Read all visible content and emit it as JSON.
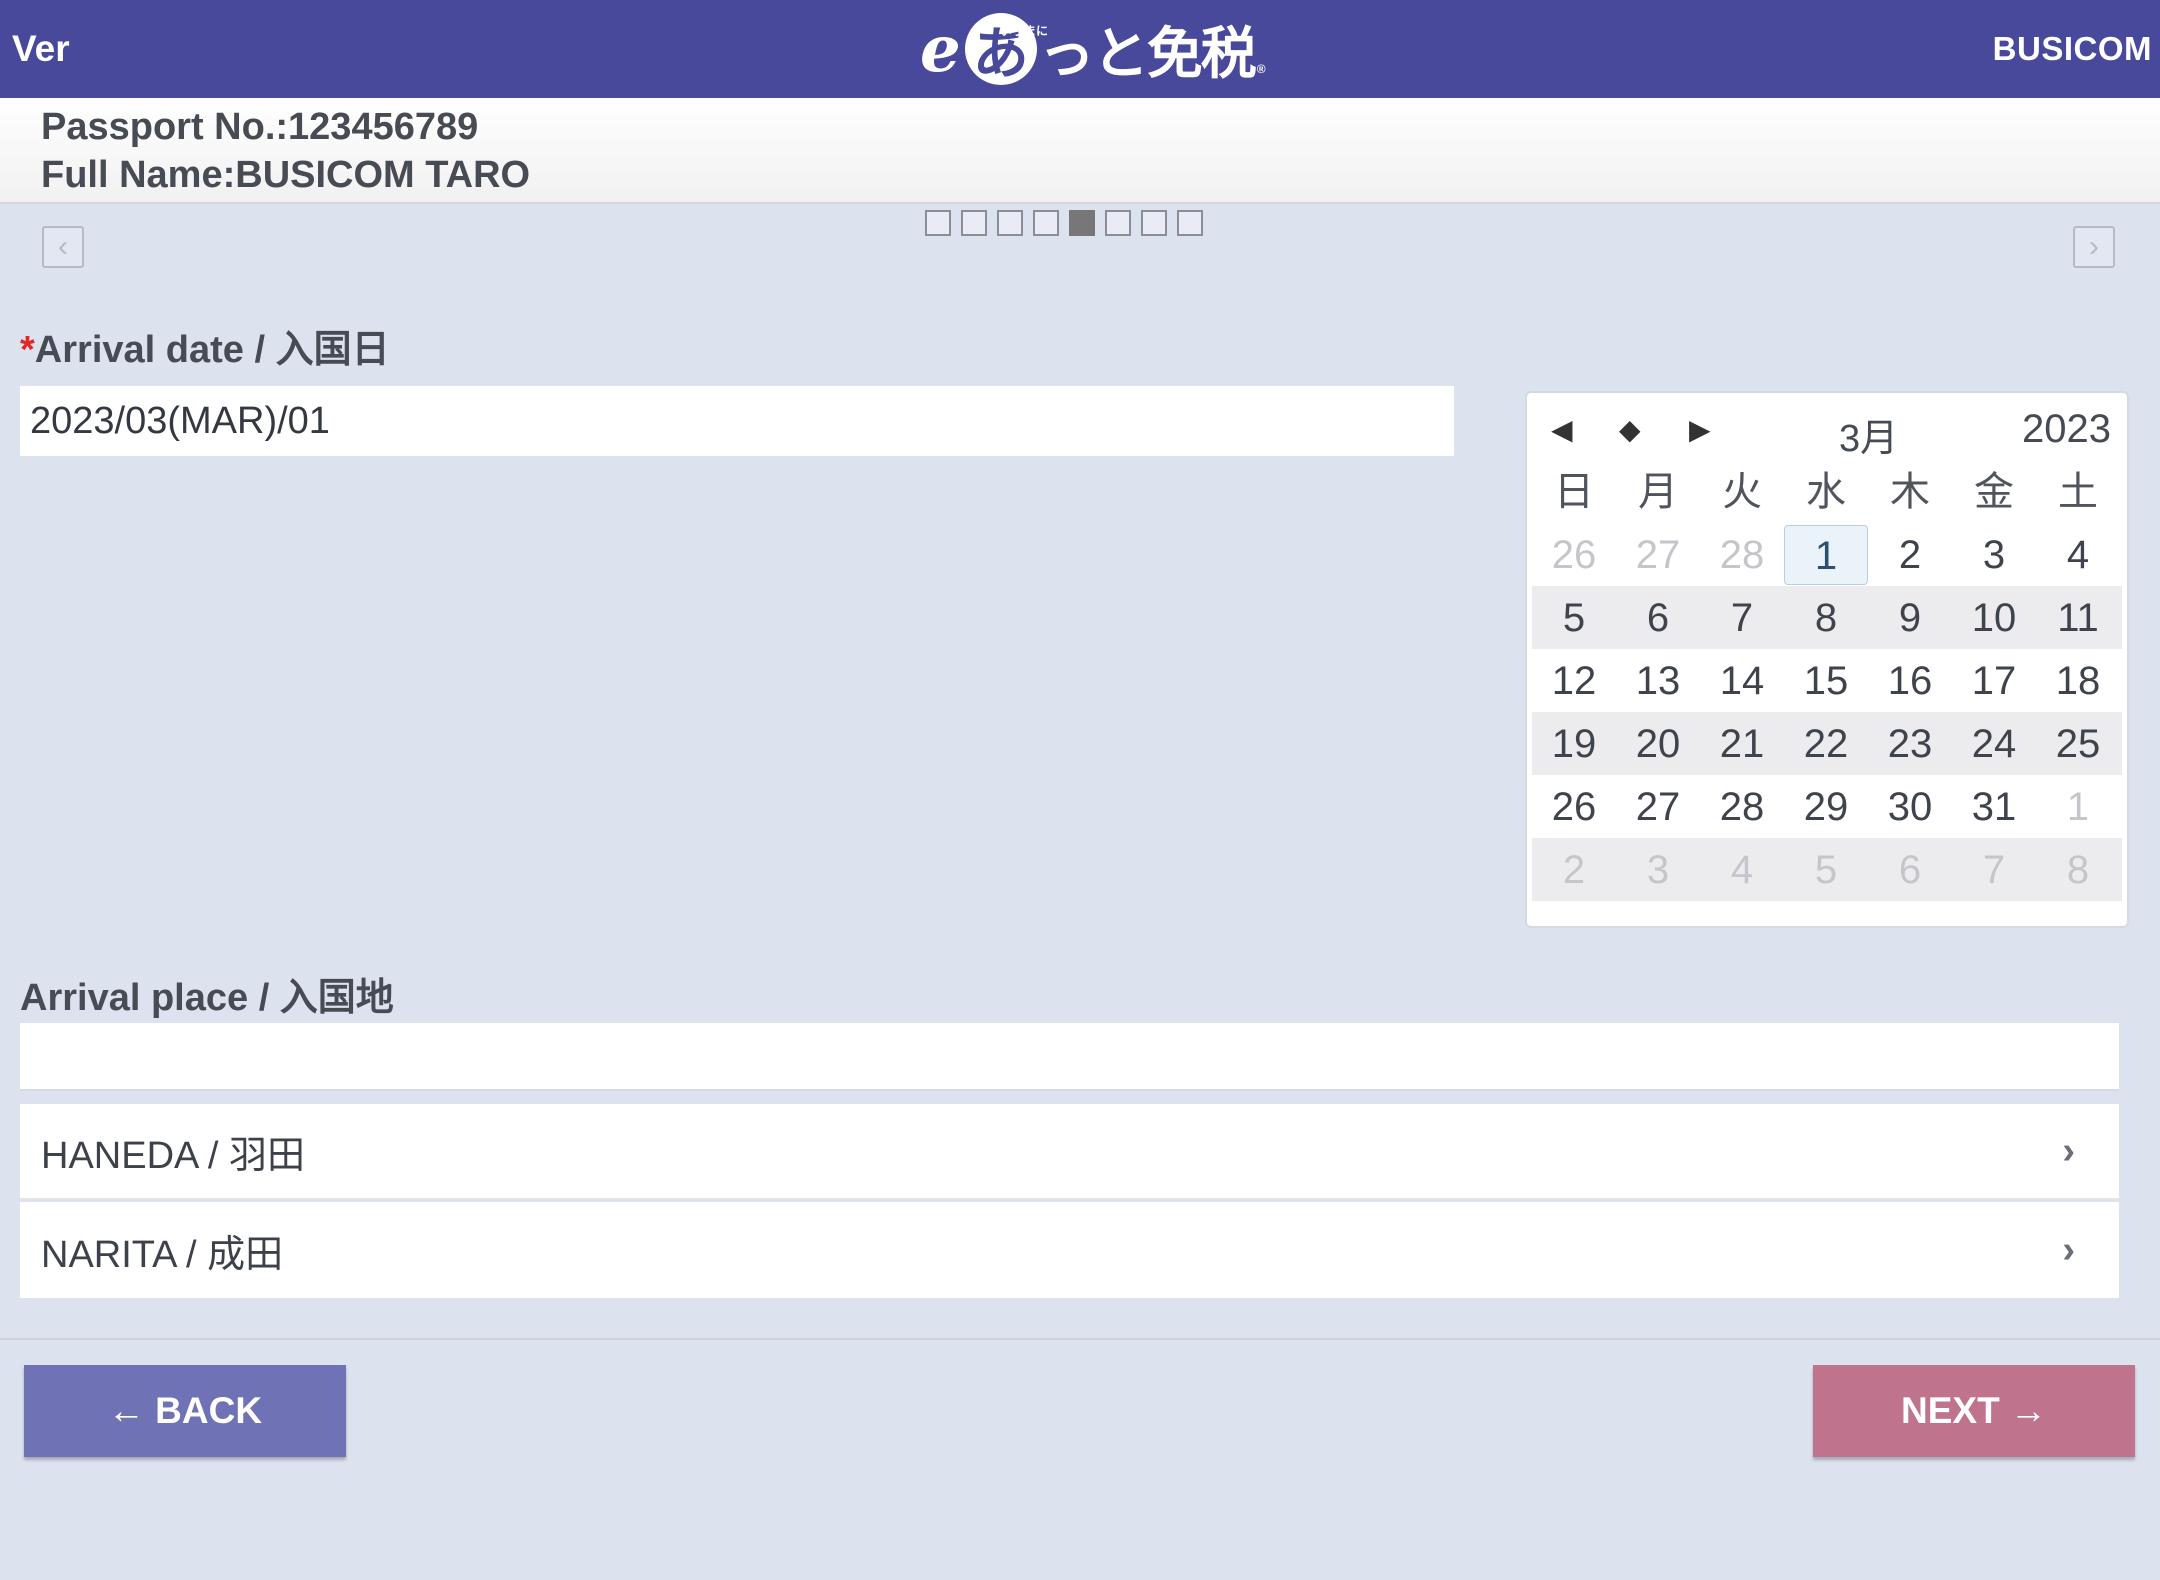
{
  "header": {
    "ver": "Ver",
    "logo_e": "e",
    "logo_a": "あ",
    "logo_small": "いうまに",
    "logo_rest": "っと免税",
    "logo_reg": "®",
    "brand": "BUSICOM"
  },
  "passport": {
    "number_line": "Passport No.:123456789",
    "name_line": "Full Name:BUSICOM TARO"
  },
  "pager": {
    "total": 8,
    "active_index": 4
  },
  "nav": {
    "prev": "‹",
    "next": "›"
  },
  "arrival_date": {
    "required_mark": "*",
    "label": "Arrival date / 入国日",
    "value": "2023/03(MAR)/01"
  },
  "calendar": {
    "prev": "◀",
    "today": "◆",
    "next": "▶",
    "month": "3月",
    "year": "2023",
    "weekdays": [
      "日",
      "月",
      "火",
      "水",
      "木",
      "金",
      "土"
    ],
    "weeks": [
      [
        "26",
        "27",
        "28",
        "1",
        "2",
        "3",
        "4"
      ],
      [
        "5",
        "6",
        "7",
        "8",
        "9",
        "10",
        "11"
      ],
      [
        "12",
        "13",
        "14",
        "15",
        "16",
        "17",
        "18"
      ],
      [
        "19",
        "20",
        "21",
        "22",
        "23",
        "24",
        "25"
      ],
      [
        "26",
        "27",
        "28",
        "29",
        "30",
        "31",
        "1"
      ],
      [
        "2",
        "3",
        "4",
        "5",
        "6",
        "7",
        "8"
      ]
    ],
    "selected": "1"
  },
  "arrival_place": {
    "label": "Arrival place / 入国地",
    "input_value": "",
    "options": [
      {
        "label": "HANEDA / 羽田",
        "chevron": "›"
      },
      {
        "label": "NARITA / 成田",
        "chevron": "›"
      }
    ]
  },
  "buttons": {
    "back": "← BACK",
    "next": "NEXT →"
  },
  "colors": {
    "header_bg": "#48499b",
    "page_bg": "#dde2ef",
    "back_button": "#7072b6",
    "next_button": "#c0738c",
    "required": "#e32727"
  }
}
